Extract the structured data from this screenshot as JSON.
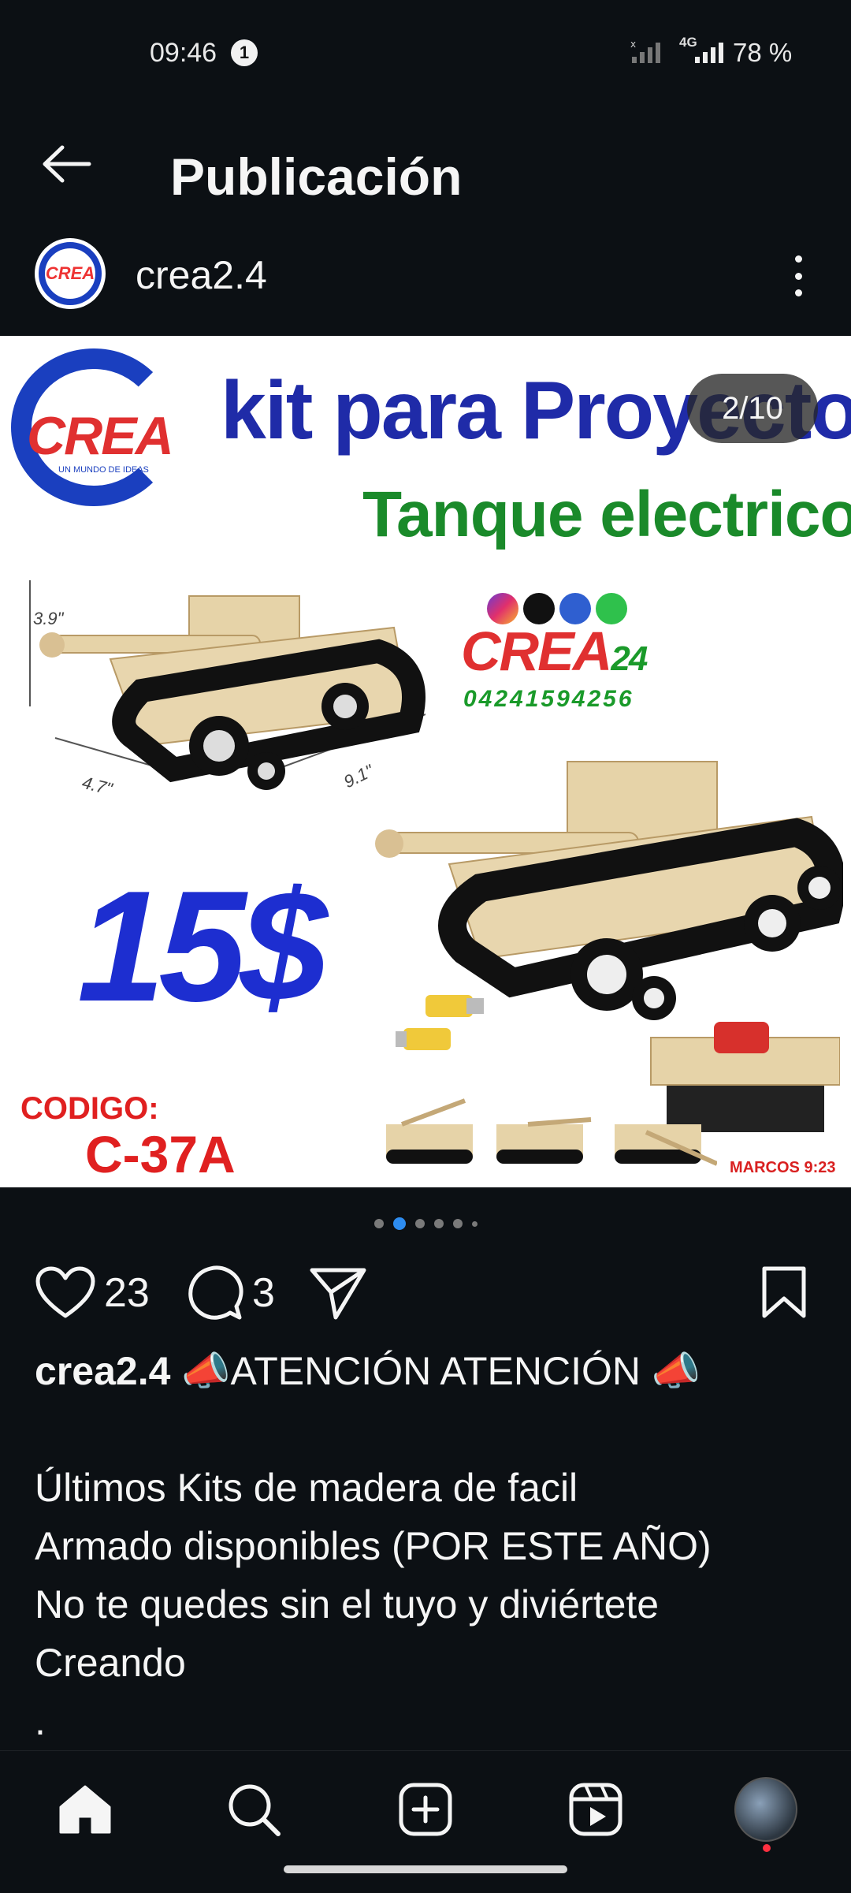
{
  "status_bar": {
    "time": "09:46",
    "notification_count": "1",
    "network": "4G",
    "battery": "78 %"
  },
  "header": {
    "title": "Publicación"
  },
  "post": {
    "username": "crea2.4",
    "slide_counter": "2/10",
    "slide_total": 10,
    "slide_current": 2,
    "image": {
      "title": "kit para Proyecto",
      "subtitle": "Tanque electrico",
      "logo_text": "CREA",
      "logo_tagline": "UN MUNDO DE IDEAS",
      "brand_text": "CREA",
      "brand_suffix": "24",
      "phone": "04241594256",
      "price": "15$",
      "code_label": "CODIGO:",
      "code_value": "C-37A",
      "verse": "MARCOS 9:23",
      "dim_height": "3.9\"",
      "dim_width": "4.7\"",
      "dim_length": "9.1\""
    }
  },
  "actions": {
    "likes": "23",
    "comments": "3"
  },
  "caption": {
    "username": "crea2.4",
    "headline": "📣ATENCIÓN ATENCIÓN 📣",
    "lines": [
      "Últimos Kits de madera de facil",
      "Armado disponibles (POR ESTE AÑO)",
      "No te quedes sin el tuyo y diviértete",
      "Creando",
      "."
    ]
  },
  "colors": {
    "background": "#0c1014",
    "accent": "#2d8cf0",
    "notification_dot": "#ff3040"
  },
  "bottom_nav": [
    "home-icon",
    "search-icon",
    "create-icon",
    "reels-icon",
    "profile-avatar"
  ]
}
